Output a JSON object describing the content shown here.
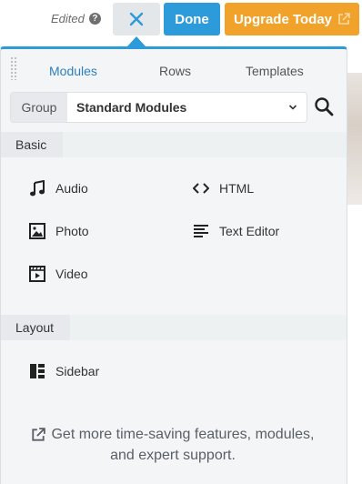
{
  "topbar": {
    "edited_label": "Edited",
    "help_icon": "question-circle-icon",
    "close_icon": "close-x-icon",
    "done_label": "Done",
    "upgrade_label": "Upgrade Today",
    "upgrade_icon": "external-link-icon"
  },
  "panel": {
    "tabs": [
      {
        "label": "Modules",
        "active": true
      },
      {
        "label": "Rows",
        "active": false
      },
      {
        "label": "Templates",
        "active": false
      }
    ],
    "group": {
      "label": "Group",
      "value": "Standard Modules"
    },
    "sections": [
      {
        "title": "Basic",
        "modules": [
          {
            "label": "Audio",
            "icon": "music-note-icon"
          },
          {
            "label": "HTML",
            "icon": "code-brackets-icon"
          },
          {
            "label": "Photo",
            "icon": "photo-icon"
          },
          {
            "label": "Text Editor",
            "icon": "text-align-icon"
          },
          {
            "label": "Video",
            "icon": "video-icon"
          }
        ]
      },
      {
        "title": "Layout",
        "modules": [
          {
            "label": "Sidebar",
            "icon": "sidebar-layout-icon"
          }
        ]
      }
    ],
    "promo": {
      "line1": "Get more time-saving features, modules,",
      "line2": "and expert support."
    }
  },
  "colors": {
    "accent_blue": "#2d9ad9",
    "upgrade_orange": "#f0a22b",
    "panel_bg": "#f3f5f7"
  }
}
